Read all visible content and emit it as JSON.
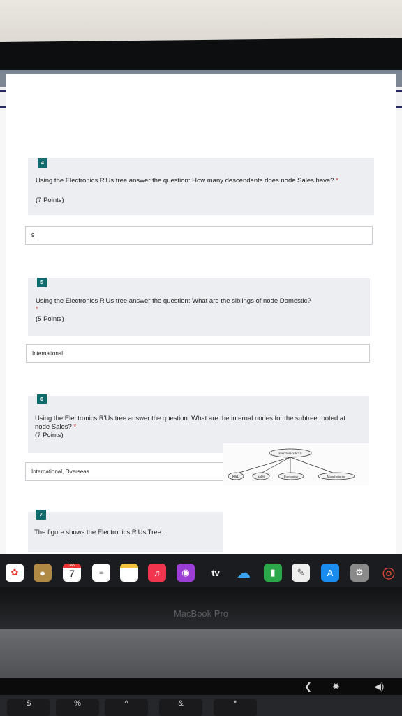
{
  "questions": [
    {
      "number": "4",
      "text": "Using the Electronics R'Us tree answer the question: How many descendants does node Sales have?",
      "required_mark": "*",
      "points": "(7 Points)",
      "answer": "9"
    },
    {
      "number": "5",
      "text": "Using the Electronics R'Us tree answer the question: What are the siblings of node Domestic?",
      "required_mark": "*",
      "points": "(5 Points)",
      "answer": "International"
    },
    {
      "number": "6",
      "text": "Using the Electronics R'Us tree answer the question: What are the internal nodes for the subtree rooted at node Sales?",
      "required_mark": "*",
      "points": "(7 Points)",
      "answer": "International, Overseas"
    },
    {
      "number": "7",
      "text": "The figure shows the Electronics R'Us Tree."
    }
  ],
  "tree_figure": {
    "root": "Electronics R'Us",
    "children": [
      "R&D",
      "Sales",
      "Purchasing",
      "Manufacturing"
    ]
  },
  "dock": {
    "calendar_month": "JAN",
    "calendar_day": "7",
    "tv_label": "tv"
  },
  "laptop": {
    "brand": "MacBook Pro"
  },
  "keyboard": {
    "keys": [
      "$",
      "%",
      "^",
      "&",
      "*"
    ]
  }
}
